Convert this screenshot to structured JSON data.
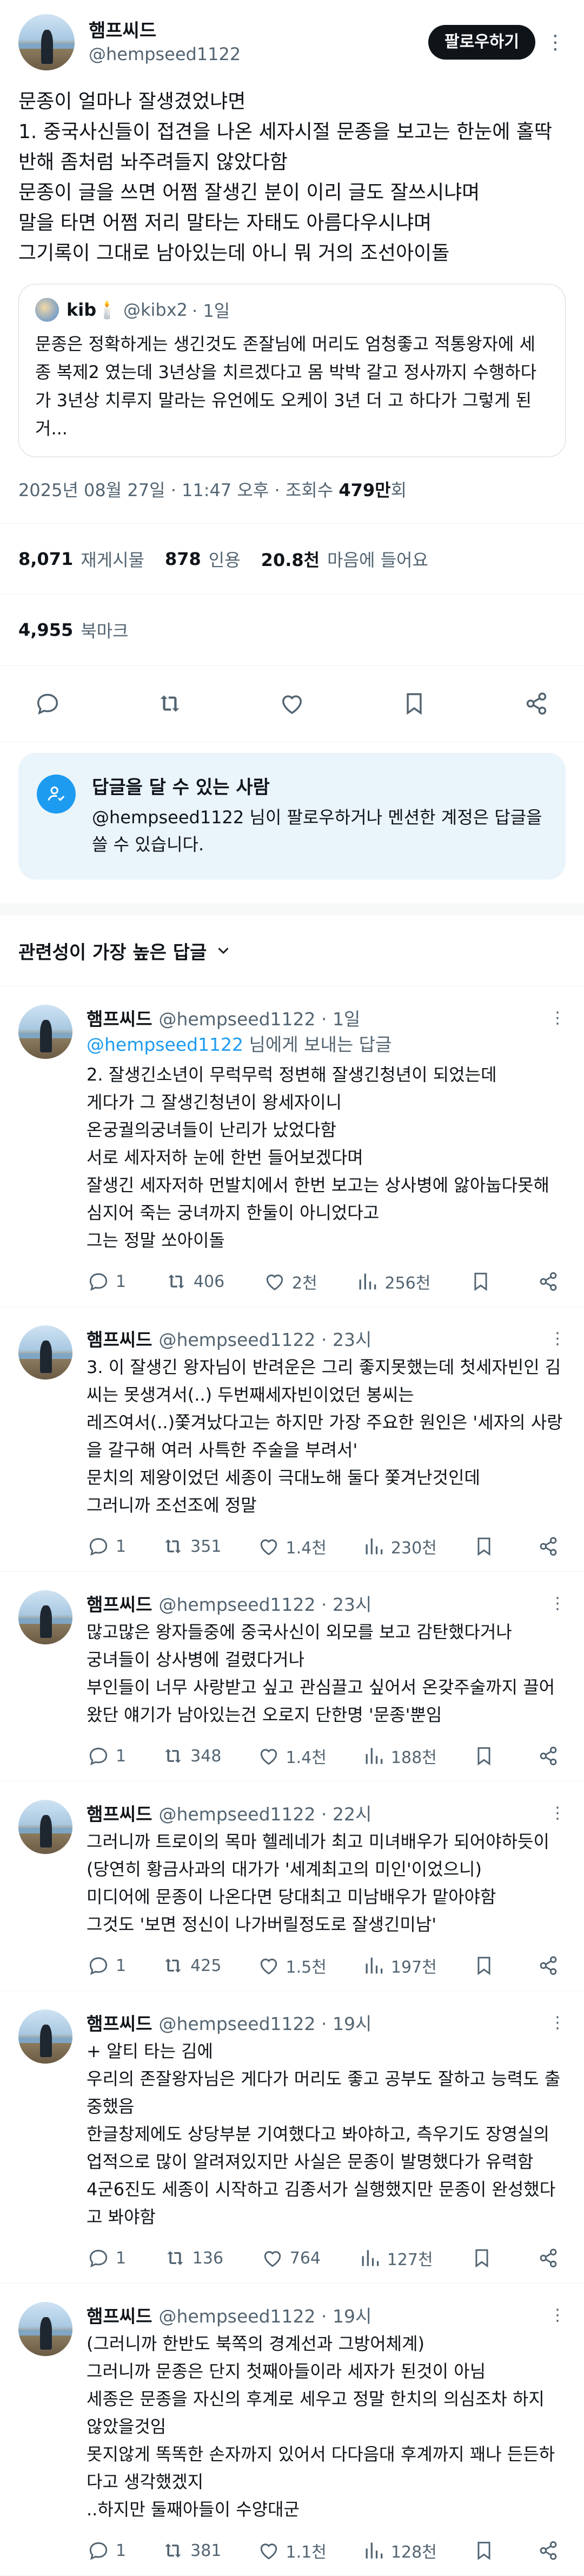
{
  "post": {
    "author_name": "햄프씨드",
    "author_handle": "@hempseed1122",
    "follow_label": "팔로우하기",
    "text": "문종이 얼마나 잘생겼었냐면\n1. 중국사신들이 접견을 나온 세자시절 문종을 보고는 한눈에 홀딱 반해 좀처럼 놔주려들지 않았다함\n문종이 글을 쓰면 어쩜 잘생긴 분이 이리 글도 잘쓰시냐며\n말을 타면 어쩜 저리 말타는 자태도 아름다우시냐며\n그기록이 그대로 남아있는데 아니 뭐 거의 조선아이돌",
    "quote": {
      "name": "kib🕯️",
      "handle": "@kibx2",
      "time": "· 1일",
      "text": "문종은 정확하게는 생긴것도 존잘님에 머리도 엄청좋고 적통왕자에 세종 복제2 였는데 3년상을 치르겠다고 몸 박박 갈고 정사까지 수행하다가 3년상 치루지 말라는 유언에도 오케이 3년 더 고 하다가 그렇게 된거..."
    },
    "timestamp": "2025년 08월 27일 · 11:47 오후 · 조회수 ",
    "views": "479만",
    "views_suffix": "회",
    "reposts": "8,071",
    "reposts_label": "재게시물",
    "quotes": "878",
    "quotes_label": "인용",
    "likes": "20.8천",
    "likes_label": "마음에 들어요",
    "bookmarks": "4,955",
    "bookmarks_label": "북마크"
  },
  "notice": {
    "title": "답글을 달 수 있는 사람",
    "text": "@hempseed1122 님이 팔로우하거나 멘션한 계정은 답글을 쓸 수 있습니다."
  },
  "sort_label": "관련성이 가장 높은 답글",
  "replies": [
    {
      "name": "햄프씨드",
      "handle": "@hempseed1122 · 1일",
      "replying_to": "@hempseed1122",
      "replying_suffix": " 님에게 보내는 답글",
      "text": "2. 잘생긴소년이 무럭무럭 정변해 잘생긴청년이 되었는데\n게다가 그 잘생긴청년이 왕세자이니\n온궁궐의궁녀들이 난리가 났었다함\n서로 세자저하 눈에 한번 들어보겠다며\n잘생긴 세자저하 먼발치에서 한번 보고는 상사병에 앓아눕다못해 심지어 죽는 궁녀까지 한둘이 아니었다고\n그는 정말 쏘아이돌",
      "replies": "1",
      "reposts": "406",
      "likes": "2천",
      "views": "256천"
    },
    {
      "name": "햄프씨드",
      "handle": "@hempseed1122 · 23시",
      "replying_to": "",
      "replying_suffix": "",
      "text": "3. 이 잘생긴 왕자님이 반려운은 그리 좋지못했는데 첫세자빈인 김씨는 못생겨서(..) 두번째세자빈이었던 봉씨는\n레즈여서(..)쫓겨났다고는 하지만 가장 주요한 원인은 '세자의 사랑을 갈구해 여러 사특한 주술을 부려서'\n문치의 제왕이었던 세종이 극대노해 둘다 쫓겨난것인데\n그러니까 조선조에 정말",
      "replies": "1",
      "reposts": "351",
      "likes": "1.4천",
      "views": "230천"
    },
    {
      "name": "햄프씨드",
      "handle": "@hempseed1122 · 23시",
      "replying_to": "",
      "replying_suffix": "",
      "text": "많고많은 왕자들중에 중국사신이 외모를 보고 감탄했다거나\n궁녀들이 상사병에 걸렸다거나\n부인들이 너무 사랑받고 싶고 관심끌고 싶어서 온갖주술까지 끌어왔단 얘기가 남아있는건 오로지 단한명 '문종'뿐임",
      "replies": "1",
      "reposts": "348",
      "likes": "1.4천",
      "views": "188천"
    },
    {
      "name": "햄프씨드",
      "handle": "@hempseed1122 · 22시",
      "replying_to": "",
      "replying_suffix": "",
      "text": "그러니까 트로이의 목마 헬레네가 최고 미녀배우가 되어야하듯이(당연히 황금사과의 대가가 '세계최고의 미인'이었으니)\n미디어에 문종이 나온다면 당대최고 미남배우가 맡아야함\n그것도 '보면 정신이 나가버릴정도로 잘생긴미남'",
      "replies": "1",
      "reposts": "425",
      "likes": "1.5천",
      "views": "197천"
    },
    {
      "name": "햄프씨드",
      "handle": "@hempseed1122 · 19시",
      "replying_to": "",
      "replying_suffix": "",
      "text": "+ 알티 타는 김에\n우리의 존잘왕자님은 게다가 머리도 좋고 공부도 잘하고 능력도 출중했음\n한글창제에도 상당부분 기여했다고 봐야하고, 측우기도 장영실의 업적으로 많이 알려져있지만 사실은 문종이 발명했다가 유력함\n4군6진도 세종이 시작하고 김종서가 실행했지만 문종이 완성했다고 봐야함",
      "replies": "1",
      "reposts": "136",
      "likes": "764",
      "views": "127천"
    },
    {
      "name": "햄프씨드",
      "handle": "@hempseed1122 · 19시",
      "replying_to": "",
      "replying_suffix": "",
      "text": "(그러니까 한반도 북쪽의 경계선과 그방어체계)\n그러니까 문종은 단지 첫째아들이라 세자가 된것이 아님\n세종은 문종을 자신의 후계로 세우고 정말 한치의 의심조차 하지 않았을것임\n못지않게 똑똑한 손자까지 있어서 다다음대 후계까지 꽤나 든든하다고 생각했겠지\n..하지만 둘째아들이 수양대군",
      "replies": "1",
      "reposts": "381",
      "likes": "1.1천",
      "views": "128천"
    }
  ]
}
